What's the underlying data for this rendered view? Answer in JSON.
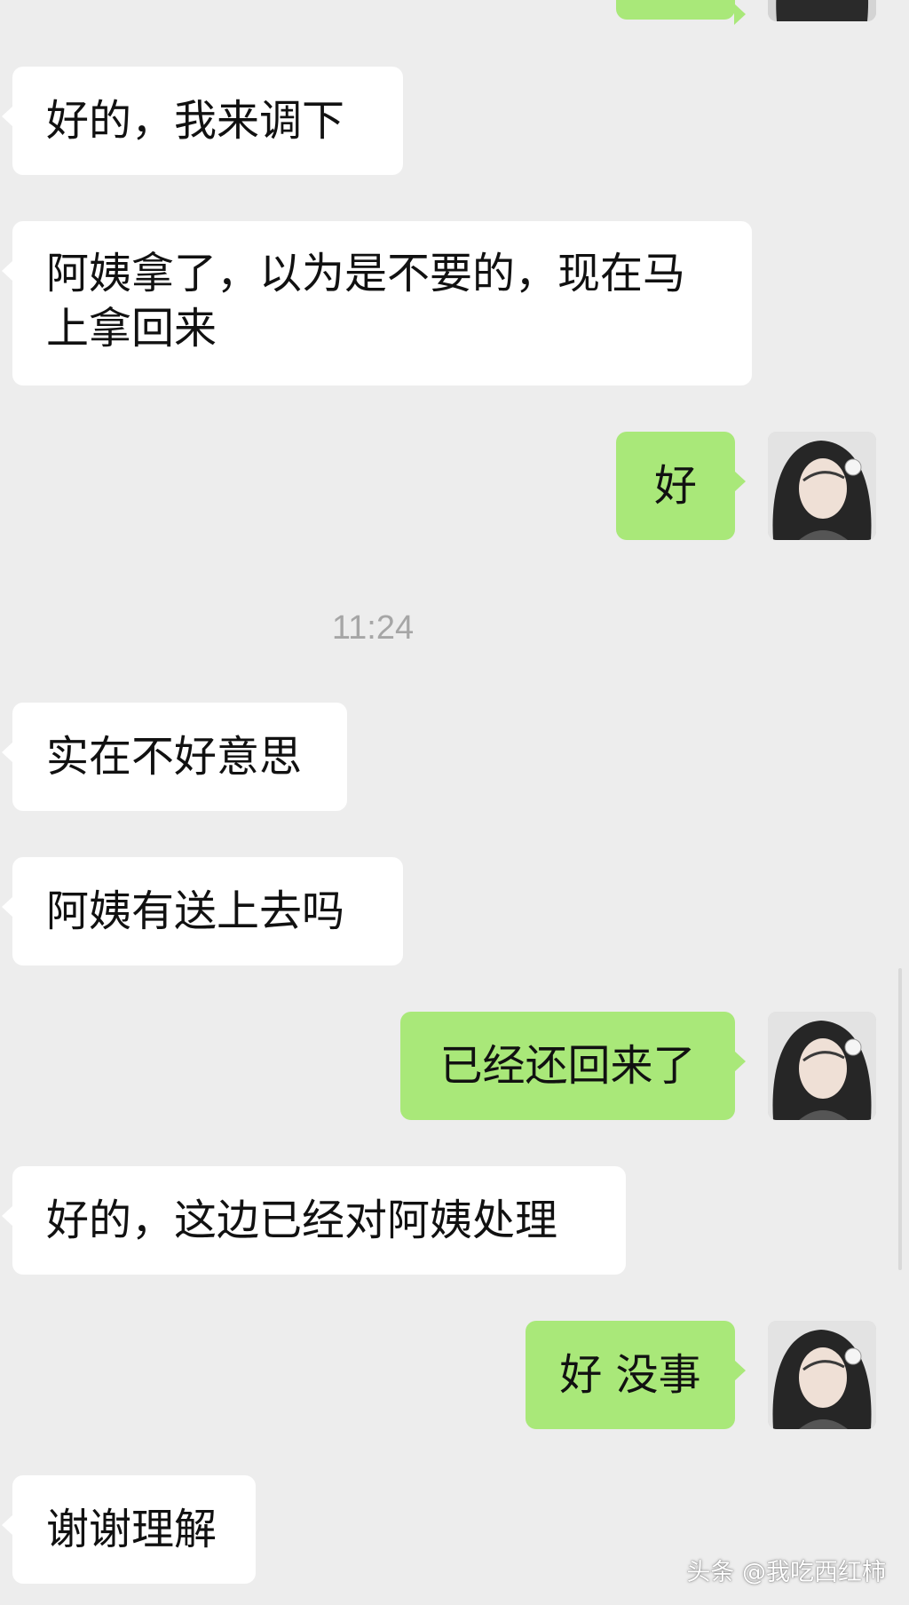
{
  "messages": [
    {
      "side": "out",
      "text": ""
    },
    {
      "side": "in",
      "text": "好的，我来调下"
    },
    {
      "side": "in",
      "text": "阿姨拿了，以为是不要的，现在马上拿回来"
    },
    {
      "side": "out",
      "text": "好"
    },
    {
      "side": "in",
      "text": "实在不好意思"
    },
    {
      "side": "in",
      "text": "阿姨有送上去吗"
    },
    {
      "side": "out",
      "text": "已经还回来了"
    },
    {
      "side": "in",
      "text": "好的，这边已经对阿姨处理"
    },
    {
      "side": "out",
      "text": "好 没事"
    },
    {
      "side": "in",
      "text": "谢谢理解"
    }
  ],
  "timestamp": "11:24",
  "watermark": "头条 @我吃西红柿",
  "colors": {
    "background": "#ededed",
    "incoming_bubble": "#ffffff",
    "outgoing_bubble": "#a9e879",
    "timestamp_text": "#a6a6a6"
  },
  "icons": {
    "self_avatar": "avatar-photo"
  }
}
